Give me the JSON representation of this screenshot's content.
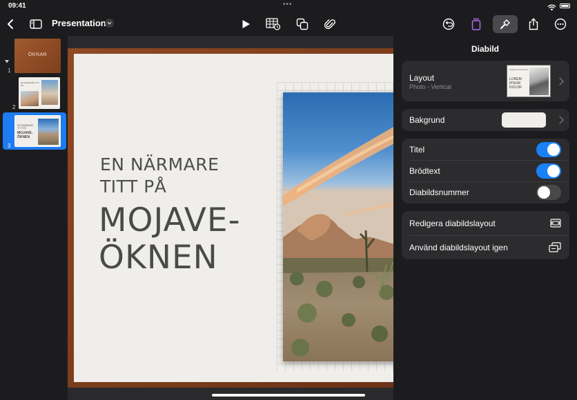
{
  "status": {
    "time": "09:41",
    "dots": "•••"
  },
  "toolbar": {
    "title": "Presentation",
    "icons": [
      "back-chevron-icon",
      "sidebar-toggle-icon",
      "dropdown-chevron-icon",
      "play-icon",
      "table-icon",
      "shapes-icon",
      "attachment-icon",
      "undo-icon",
      "trash-icon",
      "format-brush-icon",
      "share-icon",
      "more-icon"
    ]
  },
  "navigator": {
    "slides": [
      {
        "number": "1",
        "title": "ÖKNAR"
      },
      {
        "number": "2",
        "title": ""
      },
      {
        "number": "3",
        "title": "",
        "selected": true
      }
    ]
  },
  "slide": {
    "heading_line1": "EN NÄRMARE",
    "heading_line2": "TITT PÅ",
    "title_line1": "MOJAVE-",
    "title_line2": "ÖKNEN"
  },
  "thumbs": {
    "s2_text": "EN NÄRMARE TITT PÅ",
    "s3_text1": "EN NÄRMARE TITT PÅ",
    "s3_text2": "MOJAVE-ÖKNEN",
    "layout_text": "LOREM IPSUM DOLOR",
    "layout_small": "LOREM IPSUM DOLOR"
  },
  "inspector": {
    "title": "Diabild",
    "layout_label": "Layout",
    "layout_value": "Photo - Vertical",
    "background_label": "Bakgrund",
    "toggles": [
      {
        "label": "Titel",
        "on": true
      },
      {
        "label": "Brödtext",
        "on": true
      },
      {
        "label": "Diabildsnummer",
        "on": false
      }
    ],
    "edit_layout": "Redigera diabildslayout",
    "reapply_layout": "Använd diabildslayout igen"
  },
  "colors": {
    "accent": "#1a82f6",
    "frame": "#7a3b1a",
    "paper": "#efeeea"
  }
}
